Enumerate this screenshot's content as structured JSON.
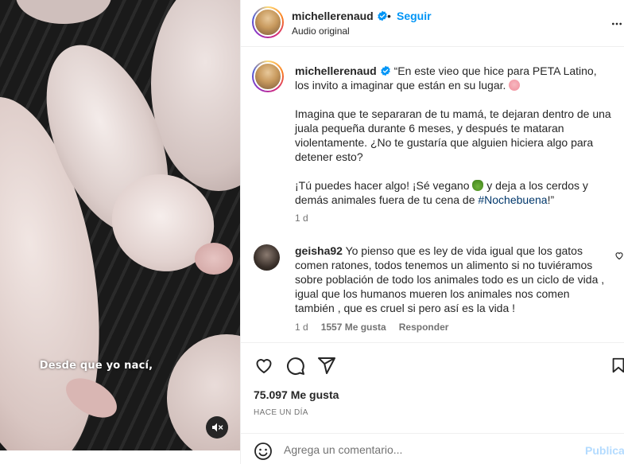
{
  "video": {
    "subtitle": "Desde que yo nací,",
    "mute_icon": "speaker-muted-icon"
  },
  "header": {
    "username": "michellerenaud",
    "separator": "•",
    "follow_label": "Seguir",
    "audio_label": "Audio original",
    "more_icon": "more-options-icon"
  },
  "caption": {
    "username": "michellerenaud",
    "paragraph_1": "“En este vieo que hice para PETA Latino, los invito a imaginar que están en su lugar.",
    "paragraph_2": "Imagina que te separaran de tu mamá, te dejaran dentro de una juala pequeña durante 6 meses, y después te mataran violentamente. ¿No te gustaría que alguien hiciera algo para detener esto?",
    "paragraph_3a": "¡Tú puedes hacer algo! ¡Sé vegano ",
    "paragraph_3b": " y deja a los cerdos y demás animales fuera de tu cena de ",
    "hashtag": "#Nochebuena",
    "paragraph_3c": "!”",
    "time": "1 d"
  },
  "comment": {
    "username": "geisha92",
    "text": "Yo pienso que es ley de vida igual que los gatos comen ratones, todos tenemos un alimento si no tuviéramos sobre población de todo los animales todo es un ciclo de vida , igual que los humanos mueren los animales nos comen también , que es cruel si pero así es la vida !",
    "time": "1 d",
    "likes": "1557 Me gusta",
    "reply_label": "Responder"
  },
  "actions": {
    "likes": "75.097 Me gusta",
    "time_ago": "HACE UN DÍA"
  },
  "add_comment": {
    "placeholder": "Agrega un comentario...",
    "publish_label": "Publicar"
  },
  "colors": {
    "accent": "#0095f6",
    "text": "#262626",
    "muted": "#737373",
    "hashtag": "#00376b",
    "publish_disabled": "#b3dbff"
  }
}
